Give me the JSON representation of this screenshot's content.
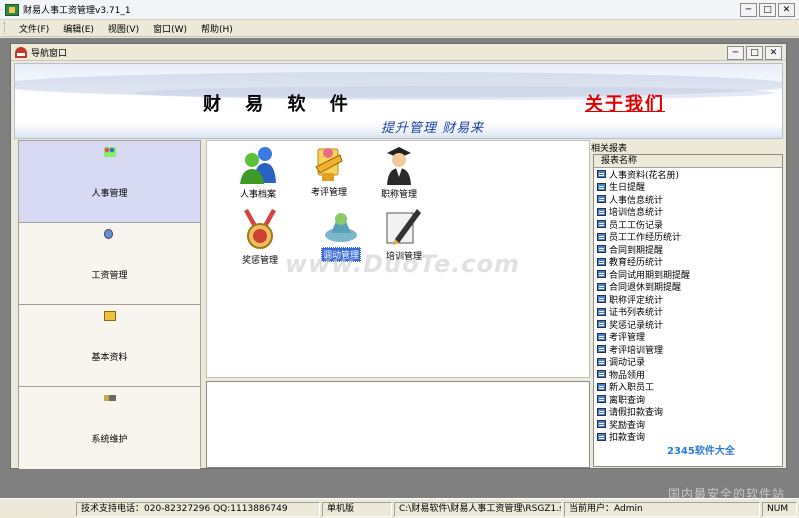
{
  "window": {
    "title": "财易人事工资管理v3.71_1",
    "min_label": "─",
    "max_label": "□",
    "close_label": "✕"
  },
  "menu": [
    "文件(F)",
    "编辑(E)",
    "视图(V)",
    "窗口(W)",
    "帮助(H)"
  ],
  "child_window": {
    "title": "导航窗口",
    "min_label": "─",
    "max_label": "□",
    "close_label": "✕"
  },
  "banner": {
    "brand": "财 易 软 件",
    "about": "关于我们",
    "slogan": "提升管理 财易来"
  },
  "nav": [
    {
      "label": "人事管理",
      "icon": "people-icon",
      "active": true
    },
    {
      "label": "工资管理",
      "icon": "money-icon",
      "active": false
    },
    {
      "label": "基本资料",
      "icon": "document-icon",
      "active": false
    },
    {
      "label": "系统维护",
      "icon": "tools-icon",
      "active": false
    }
  ],
  "features": [
    {
      "label": "人事档案",
      "icon": "personnel-file-icon"
    },
    {
      "label": "考评管理",
      "icon": "evaluation-icon"
    },
    {
      "label": "职称管理",
      "icon": "title-icon"
    },
    {
      "label": "奖惩管理",
      "icon": "reward-icon"
    },
    {
      "label": "调动管理",
      "icon": "transfer-icon",
      "selected": true
    },
    {
      "label": "培训管理",
      "icon": "training-icon"
    }
  ],
  "watermark": "www.DuoTe.com",
  "reports": {
    "title": "相关报表",
    "column_header": "报表名称",
    "items": [
      "人事资料(花名册)",
      "生日提醒",
      "人事信息统计",
      "培训信息统计",
      "员工工伤记录",
      "员工工作经历统计",
      "合同到期提醒",
      "教育经历统计",
      "合同试用期到期提醒",
      "合同退休到期提醒",
      "职称评定统计",
      "证书列表统计",
      "奖惩记录统计",
      "考评管理",
      "考评培训管理",
      "调动记录",
      "物品领用",
      "新入职员工",
      "离职查询",
      "请假扣款查询",
      "奖励查询",
      "扣款查询"
    ]
  },
  "site_watermark": "2345软件大全",
  "site_watermark_sub": "国内最安全的软件站",
  "status": {
    "support": "技术支持电话：020-82327296 QQ:1113886749",
    "edition": "单机版",
    "path": "C:\\财易软件\\财易人事工资管理\\RSGZ1.sys",
    "user": "当前用户：Admin",
    "num": "NUM"
  }
}
